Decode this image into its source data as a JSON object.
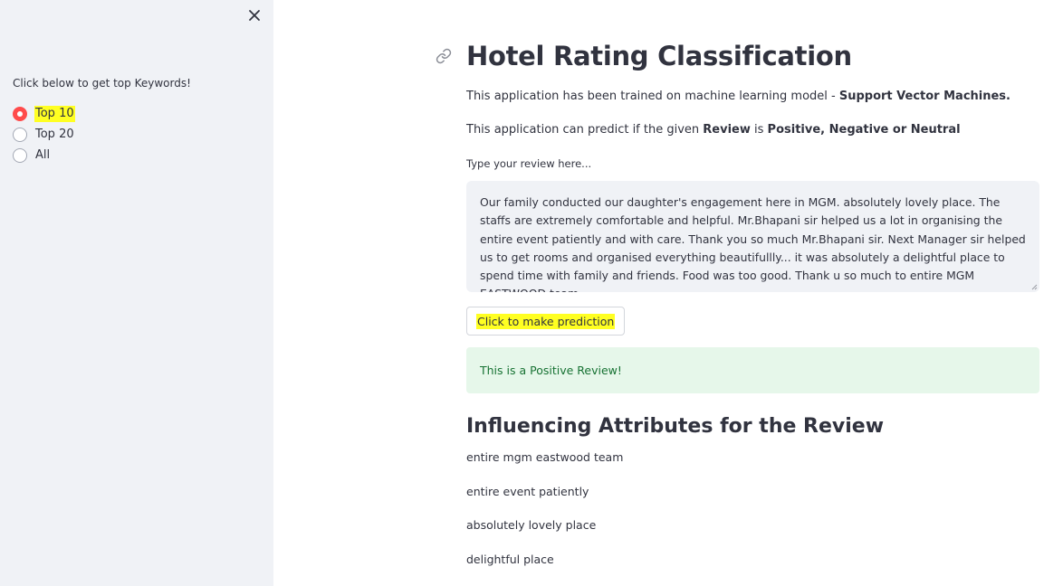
{
  "sidebar": {
    "prompt": "Click below to get top Keywords!",
    "options": [
      "Top 10",
      "Top 20",
      "All"
    ],
    "selected": "Top 10"
  },
  "main": {
    "title": "Hotel Rating Classification",
    "intro": {
      "prefix": "This application has been trained on machine learning model - ",
      "model": "Support Vector Machines."
    },
    "predict_line": {
      "prefix": "This application can predict if the given ",
      "review_word": "Review",
      "is_word": " is ",
      "classes": "Positive, Negative or Neutral"
    },
    "input_label": "Type your review here...",
    "review_text": "Our family conducted our daughter's engagement here in MGM. absolutely lovely place. The staffs are extremely comfortable and helpful. Mr.Bhapani sir helped us a lot in organising the entire event patiently and with care. Thank you so much Mr.Bhapani sir. Next Manager sir helped us to get rooms and organised everything beautifullly... it was absolutely a delightful place to spend time with family and friends. Food was too good. Thank u so much to entire MGM EASTWOOD team",
    "predict_button": "Click to make prediction",
    "result": "This is a Positive Review!",
    "attributes_heading": "Influencing Attributes for the Review",
    "attributes": [
      "entire mgm eastwood team",
      "entire event patiently",
      "absolutely lovely place",
      "delightful place"
    ]
  },
  "colors": {
    "sidebar_bg": "#f0f2f6",
    "accent": "#ff4b4b",
    "highlight": "#ffff22",
    "success_bg": "#e6f7ea",
    "success_text": "#177233",
    "text": "#31333f"
  },
  "icons": [
    "close-icon",
    "link-icon"
  ]
}
